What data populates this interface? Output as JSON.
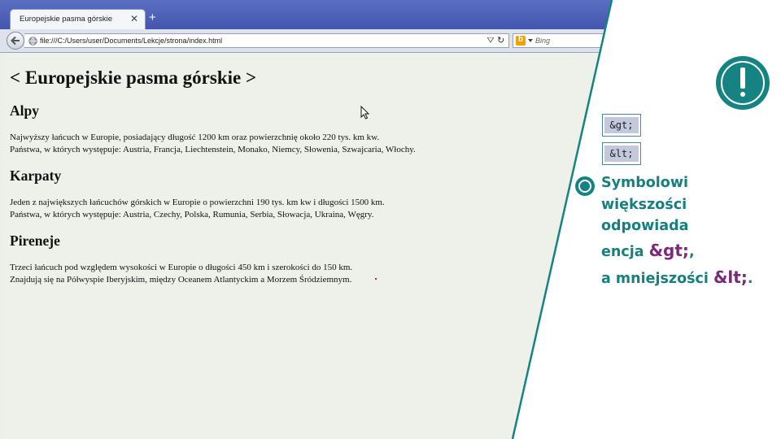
{
  "browser": {
    "tab_title": "Europejskie pasma górskie",
    "tab_close": "✕",
    "new_tab": "+",
    "url": "file:///C:/Users/user/Documents/Lekcje/strona/index.html",
    "reload_icon": "reload-icon",
    "search_placeholder": "Bing",
    "search_engine_icon": "b"
  },
  "page": {
    "title": "< Europejskie pasma górskie >",
    "sections": [
      {
        "heading": "Alpy",
        "line1": "Najwyższy łańcuch w Europie, posiadający długość 1200 km oraz powierzchnię około 220 tys. km kw.",
        "line2": "Państwa, w których występuje: Austria, Francja, Liechtenstein, Monako, Niemcy, Słowenia, Szwajcaria, Włochy."
      },
      {
        "heading": "Karpaty",
        "line1": "Jeden z największych łańcuchów górskich w Europie o powierzchni 190 tys. km kw i długości 1500 km.",
        "line2": "Państwa, w których występuje: Austria, Czechy, Polska, Rumunia, Serbia, Słowacja, Ukraina, Węgry."
      },
      {
        "heading": "Pireneje",
        "line1": "Trzeci łańcuch pod względem wysokości w Europie o długości 450 km i szerokości do 150 km.",
        "line2": "Znajdują się na Półwyspie Iberyjskim, między Oceanem Atlantyckim a Morzem Śródziemnym."
      }
    ]
  },
  "side": {
    "code_gt": "&gt;",
    "code_lt": "&lt;",
    "note_line1": "Symbolowi",
    "note_line2": "większości",
    "note_line3": "odpowiada",
    "note_line4_prefix": "encja ",
    "note_line4_entity": "&gt;",
    "note_line4_suffix": ",",
    "note_line5_prefix": "a mniejszości ",
    "note_line5_entity": "&lt;",
    "note_line5_suffix": "."
  },
  "colors": {
    "teal": "#168383",
    "entity_purple": "#7b2a7b",
    "titlebar_blue": "#4a5fb6"
  }
}
